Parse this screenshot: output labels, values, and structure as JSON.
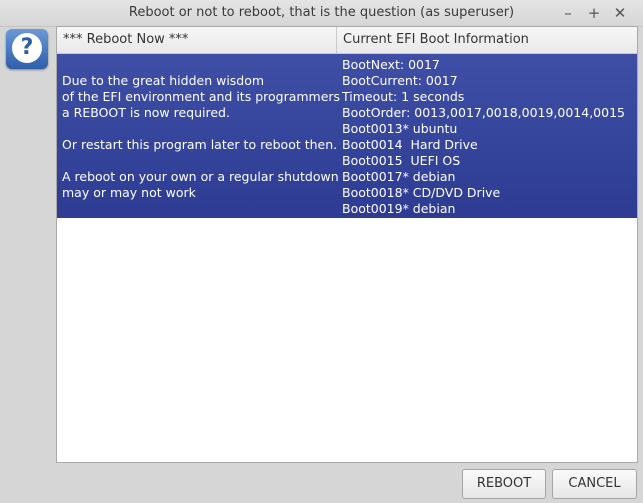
{
  "window": {
    "title": "Reboot or not to reboot, that is the question (as superuser)",
    "minimize_glyph": "–",
    "maximize_glyph": "+",
    "close_glyph": "✕"
  },
  "icon": {
    "name": "question-icon",
    "glyph": "?"
  },
  "table": {
    "columns": [
      "*** Reboot Now ***",
      "Current EFI Boot Information"
    ],
    "left_lines": [
      "Due to the great hidden wisdom",
      "of the EFI environment and its programmers",
      "a REBOOT is now required.",
      "",
      "Or restart this program later to reboot then.",
      "",
      "A reboot on your own or a regular shutdown",
      "may or may not work"
    ],
    "right_lines": [
      "BootNext: 0017",
      "BootCurrent: 0017",
      "Timeout: 1 seconds",
      "BootOrder: 0013,0017,0018,0019,0014,0015",
      "Boot0013* ubuntu",
      "Boot0014  Hard Drive",
      "Boot0015  UEFI OS",
      "Boot0017* debian",
      "Boot0018* CD/DVD Drive",
      "Boot0019* debian"
    ]
  },
  "buttons": {
    "reboot": "REBOOT",
    "cancel": "CANCEL"
  }
}
